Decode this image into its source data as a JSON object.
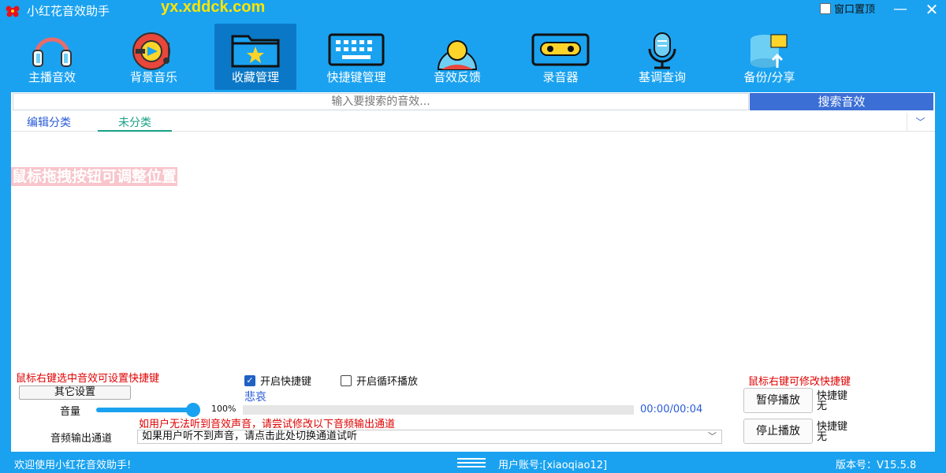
{
  "window": {
    "title": "小红花音效助手",
    "site_url": "yx.xddck.com",
    "pin_label": "窗口置顶",
    "minimize_glyph": "—",
    "close_glyph": "✕"
  },
  "toolbar": {
    "items": [
      {
        "label": "主播音效",
        "icon": "headphones-icon"
      },
      {
        "label": "背景音乐",
        "icon": "music-disc-icon"
      },
      {
        "label": "收藏管理",
        "icon": "star-folder-icon",
        "active": true
      },
      {
        "label": "快捷键管理",
        "icon": "keyboard-icon"
      },
      {
        "label": "音效反馈",
        "icon": "feedback-icon"
      },
      {
        "label": "录音器",
        "icon": "cassette-icon"
      },
      {
        "label": "基调查询",
        "icon": "microphone-icon"
      },
      {
        "label": "备份/分享",
        "icon": "database-upload-icon"
      }
    ]
  },
  "search": {
    "placeholder": "输入要搜索的音效...",
    "button_label": "搜索音效"
  },
  "tabs": [
    {
      "label": "编辑分类"
    },
    {
      "label": "未分类",
      "active": true
    }
  ],
  "drag_hint": "鼠标拖拽按钮可调整位置",
  "bottom": {
    "hint_left": "鼠标右键选中音效可设置快捷键",
    "hint_right": "鼠标右键可修改快捷键",
    "other_settings": "其它设置",
    "enable_hotkey": {
      "label": "开启快捷键",
      "checked": true
    },
    "enable_loop": {
      "label": "开启循环播放",
      "checked": false
    },
    "now_playing": "悲哀",
    "volume_label": "音量",
    "volume_percent": "100%",
    "volume_value": 1.0,
    "progress_value": 0.0,
    "time": "00:00/00:04",
    "output_hint": "如用户无法听到音效声音，请尝试修改以下音频输出通道",
    "output_label": "音频输出通道",
    "output_value": "如果用户听不到声音，请点击此处切换通道试听",
    "pause_button": "暂停播放",
    "stop_button": "停止播放",
    "hotkey_label": "快捷键",
    "hotkey_none": "无"
  },
  "status": {
    "welcome": "欢迎使用小红花音效助手!",
    "user": "用户账号:[xiaoqiao12]",
    "version": "版本号：V15.5.8"
  },
  "colors": {
    "brand": "#1aa2f0",
    "active_tool": "#0b78c7",
    "search_button": "#3b6fd6",
    "hint_red": "#e00000",
    "url_yellow": "#ffe500"
  }
}
